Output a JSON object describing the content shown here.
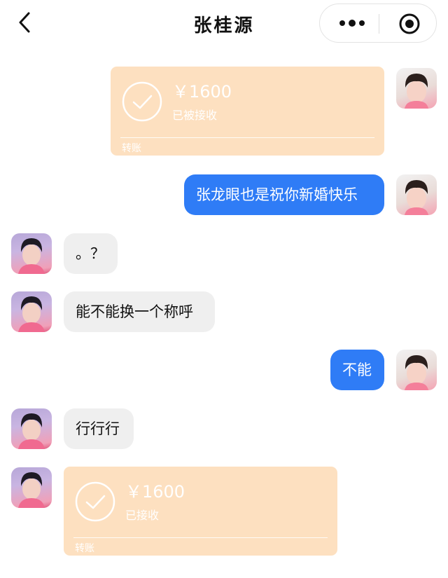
{
  "header": {
    "title": "张桂源",
    "back_icon": "chevron-left-icon",
    "more_icon": "more-dots-icon",
    "close_icon": "target-circle-icon"
  },
  "colors": {
    "blue_bubble": "#2f7cf6",
    "gray_bubble": "#efefef",
    "transfer_card": "#fde0c0"
  },
  "messages": [
    {
      "sender": "me",
      "type": "transfer",
      "amount": "￥1600",
      "status": "已被接收",
      "footer": "转账"
    },
    {
      "sender": "me",
      "type": "text",
      "text": "张龙眼也是祝你新婚快乐"
    },
    {
      "sender": "them",
      "type": "text",
      "text": "。？"
    },
    {
      "sender": "them",
      "type": "text",
      "text": "能不能换一个称呼"
    },
    {
      "sender": "me",
      "type": "text",
      "text": "不能"
    },
    {
      "sender": "them",
      "type": "text",
      "text": "行行行"
    },
    {
      "sender": "them",
      "type": "transfer",
      "amount": "￥1600",
      "status": "已接收",
      "footer": "转账"
    }
  ]
}
